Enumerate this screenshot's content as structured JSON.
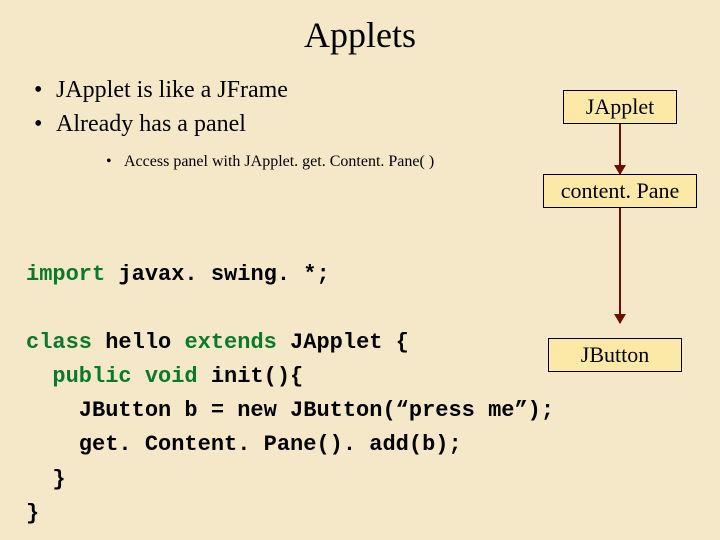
{
  "title": "Applets",
  "bullets": [
    "JApplet is like a JFrame",
    "Already has a panel"
  ],
  "subbullet": "Access panel with JApplet. get. Content. Pane( )",
  "diagram": {
    "top": "JApplet",
    "mid": "content. Pane",
    "bottom": "JButton"
  },
  "code": {
    "l1a": "import",
    "l1b": " javax. swing. *;",
    "l2a": "class",
    "l2b": " hello ",
    "l2c": "extends",
    "l2d": " JApplet {",
    "l3a": "  public void",
    "l3b": " init(){",
    "l4": "    JButton b = new JButton(“press me”);",
    "l5": "    get. Content. Pane(). add(b);",
    "l6": "  }",
    "l7": "}"
  }
}
